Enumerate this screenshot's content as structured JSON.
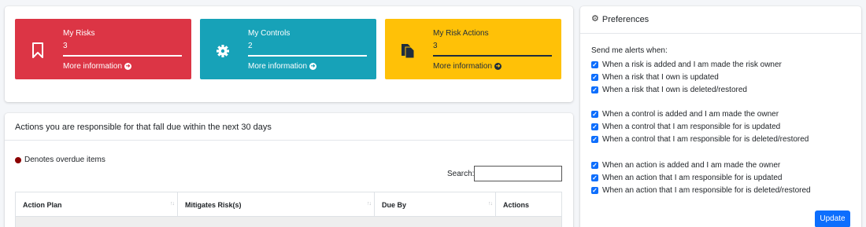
{
  "tiles": [
    {
      "label": "My Risks",
      "count": "3",
      "more": "More information",
      "icon": "bookmark-icon"
    },
    {
      "label": "My Controls",
      "count": "2",
      "more": "More information",
      "icon": "gear-icon"
    },
    {
      "label": "My Risk Actions",
      "count": "3",
      "more": "More information",
      "icon": "documents-icon"
    }
  ],
  "actions": {
    "title": "Actions you are responsible for that fall due within the next 30 days",
    "legend": "Denotes overdue items",
    "search_label": "Search:",
    "search_value": "",
    "columns": [
      "Action Plan",
      "Mitigates Risk(s)",
      "Due By",
      "Actions"
    ],
    "colors": {
      "overdue": "#8b0000"
    }
  },
  "preferences": {
    "title": "Preferences",
    "alerts_label": "Send me alerts when:",
    "options": [
      {
        "label": "When a risk is added and I am made the risk owner",
        "checked": true
      },
      {
        "label": "When a risk that I own is updated",
        "checked": true
      },
      {
        "label": "When a risk that I own is deleted/restored",
        "checked": true
      },
      {
        "label": "When a control is added and I am made the owner",
        "checked": true
      },
      {
        "label": "When a control that I am responsible for is updated",
        "checked": true
      },
      {
        "label": "When a control that I am responsible for is deleted/restored",
        "checked": true
      },
      {
        "label": "When an action is added and I am made the owner",
        "checked": true
      },
      {
        "label": "When an action that I am responsible for is updated",
        "checked": true
      },
      {
        "label": "When an action that I am responsible for is deleted/restored",
        "checked": true
      }
    ],
    "update_label": "Update"
  },
  "colors": {
    "red": "#dc3545",
    "teal": "#17a2b8",
    "yellow": "#ffc107",
    "primary": "#0d6efd"
  }
}
